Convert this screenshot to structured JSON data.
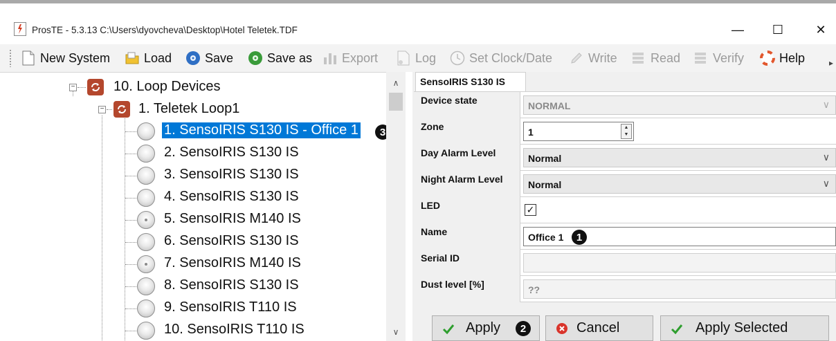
{
  "window": {
    "title": "ProsTE - 5.3.13 C:\\Users\\dyovcheva\\Desktop\\Hotel Teletek.TDF",
    "minimize": "—",
    "maximize": "☐",
    "close": "✕"
  },
  "toolbar": {
    "items": [
      {
        "label": "New System",
        "icon": "new-document-icon",
        "enabled": true
      },
      {
        "label": "Load",
        "icon": "folder-open-icon",
        "enabled": true
      },
      {
        "label": "Save",
        "icon": "save-disc-icon",
        "enabled": true
      },
      {
        "label": "Save as",
        "icon": "save-as-disc-icon",
        "enabled": true
      },
      {
        "label": "Export",
        "icon": "export-bars-icon",
        "enabled": false
      },
      {
        "label": "Log",
        "icon": "log-document-icon",
        "enabled": false
      },
      {
        "label": "Set Clock/Date",
        "icon": "clock-icon",
        "enabled": false
      },
      {
        "label": "Write",
        "icon": "pen-icon",
        "enabled": false
      },
      {
        "label": "Read",
        "icon": "read-stack-icon",
        "enabled": false
      },
      {
        "label": "Verify",
        "icon": "verify-stack-icon",
        "enabled": false
      },
      {
        "label": "Help",
        "icon": "lifebuoy-icon",
        "enabled": true
      }
    ]
  },
  "tree": {
    "root": {
      "label": "10. Loop Devices",
      "expander": "−"
    },
    "loop": {
      "label": "1. Teletek Loop1",
      "expander": "−"
    },
    "devices": [
      {
        "label": "1. SensoIRIS S130 IS - Office 1",
        "selected": true,
        "type": "S130"
      },
      {
        "label": "2. SensoIRIS S130 IS",
        "selected": false,
        "type": "S130"
      },
      {
        "label": "3. SensoIRIS S130 IS",
        "selected": false,
        "type": "S130"
      },
      {
        "label": "4. SensoIRIS S130 IS",
        "selected": false,
        "type": "S130"
      },
      {
        "label": "5. SensoIRIS M140 IS",
        "selected": false,
        "type": "M140"
      },
      {
        "label": "6. SensoIRIS S130 IS",
        "selected": false,
        "type": "S130"
      },
      {
        "label": "7. SensoIRIS M140 IS",
        "selected": false,
        "type": "M140"
      },
      {
        "label": "8. SensoIRIS S130 IS",
        "selected": false,
        "type": "S130"
      },
      {
        "label": "9. SensoIRIS T110 IS",
        "selected": false,
        "type": "T110"
      },
      {
        "label": "10. SensoIRIS T110 IS",
        "selected": false,
        "type": "T110"
      }
    ],
    "scroll_up": "∧",
    "scroll_down": "∨"
  },
  "annotations": {
    "badge1": "❶",
    "badge2": "❷",
    "badge3": "❸"
  },
  "properties": {
    "tab_label": "SensoIRIS S130 IS",
    "device_state": {
      "label": "Device state",
      "value": "NORMAL"
    },
    "zone": {
      "label": "Zone",
      "value": "1"
    },
    "day_alarm": {
      "label": "Day Alarm Level",
      "value": "Normal"
    },
    "night_alarm": {
      "label": "Night Alarm Level",
      "value": "Normal"
    },
    "led": {
      "label": "LED",
      "checked": true,
      "mark": "✓"
    },
    "name": {
      "label": "Name",
      "value": "Office 1"
    },
    "serial_id": {
      "label": "Serial ID",
      "value": ""
    },
    "dust_level": {
      "label": "Dust level [%]",
      "value": "??"
    },
    "chevron": "∨",
    "spin_up": "▲",
    "spin_down": "▼"
  },
  "buttons": {
    "apply": "Apply",
    "cancel": "Cancel",
    "apply_selected": "Apply Selected"
  },
  "colors": {
    "selection": "#0078d7",
    "loop_icon": "#b4472d",
    "ok_green": "#2e9e2e",
    "cancel_red": "#d9342b"
  }
}
